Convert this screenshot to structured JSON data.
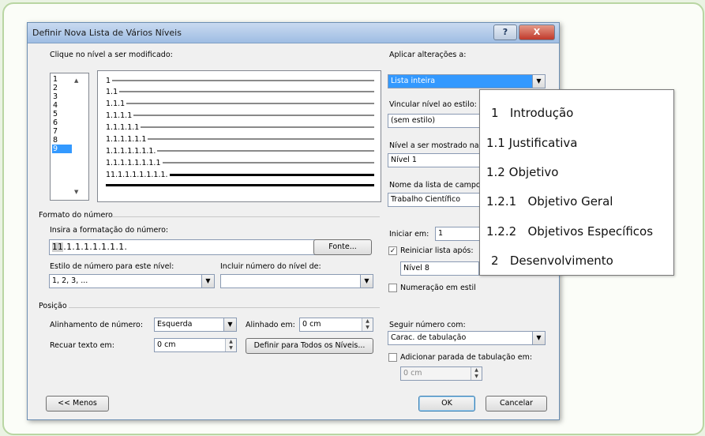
{
  "dialog": {
    "title": "Definir Nova Lista de Vários Níveis",
    "help_glyph": "?",
    "close_glyph": "X"
  },
  "level_section": {
    "label": "Clique no nível a ser modificado:",
    "levels": [
      "1",
      "2",
      "3",
      "4",
      "5",
      "6",
      "7",
      "8",
      "9"
    ],
    "selected_level": "9"
  },
  "preview_lines": [
    "1",
    "1.1",
    "1.1.1",
    "1.1.1.1",
    "1.1.1.1.1",
    "1.1.1.1.1.1",
    "1.1.1.1.1.1.1.",
    "1.1.1.1.1.1.1.1",
    "11.1.1.1.1.1.1.1."
  ],
  "right_panel": {
    "apply_label": "Aplicar alterações a:",
    "apply_value": "Lista inteira",
    "link_label": "Vincular nível ao estilo:",
    "link_value": "(sem estilo)",
    "show_label": "Nível a ser mostrado na",
    "show_value": "Nível 1",
    "name_label": "Nome da lista de campo",
    "name_value": "Trabalho Científico"
  },
  "number_format": {
    "group_label": "Formato do número",
    "enter_label": "Insira a formatação do número:",
    "format_value_prefix": "11",
    "format_value_rest": ".1.1.1.1.1.1.1.",
    "font_button": "Fonte...",
    "style_label": "Estilo de número para este nível:",
    "style_value": "1, 2, 3, ...",
    "include_label": "Incluir número do nível de:",
    "include_value": "",
    "start_label": "Iniciar em:",
    "start_value": "1",
    "restart_label": "Reiniciar lista após:",
    "restart_checked": "✓",
    "restart_value": "Nível 8",
    "legal_label": "Numeração em estil"
  },
  "position": {
    "group_label": "Posição",
    "align_label": "Alinhamento de número:",
    "align_value": "Esquerda",
    "aligned_at_label": "Alinhado em:",
    "aligned_at_value": "0 cm",
    "indent_label": "Recuar texto em:",
    "indent_value": "0 cm",
    "set_all_button": "Definir para Todos os Níveis...",
    "follow_label": "Seguir número com:",
    "follow_value": "Carac. de tabulação",
    "add_tab_label": "Adicionar parada de tabulação em:",
    "tab_value": "0 cm"
  },
  "footer": {
    "less_button": "<< Menos",
    "ok_button": "OK",
    "cancel_button": "Cancelar"
  },
  "overlay_list": [
    {
      "num": "1",
      "text": "Introdução"
    },
    {
      "num": "1.1",
      "text": "Justificativa"
    },
    {
      "num": "1.2",
      "text": "Objetivo"
    },
    {
      "num": "1.2.1",
      "text": "Objetivo Geral"
    },
    {
      "num": "1.2.2",
      "text": "Objetivos Específicos"
    },
    {
      "num": "2",
      "text": "Desenvolvimento"
    }
  ]
}
